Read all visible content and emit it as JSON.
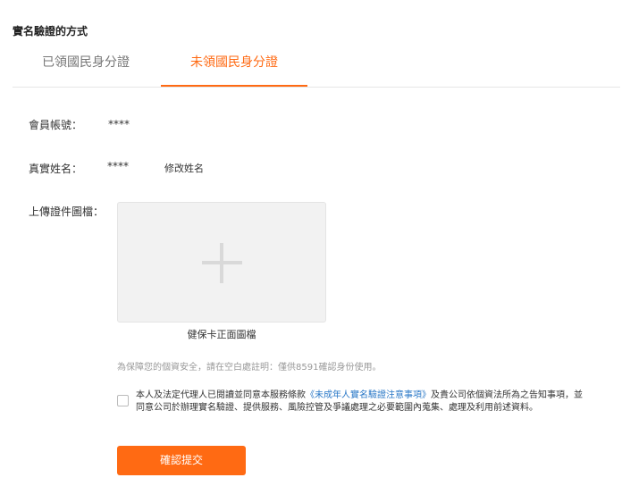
{
  "section_title": "實名驗證的方式",
  "tabs": [
    {
      "label": "已領國民身分證"
    },
    {
      "label": "未領國民身分證"
    }
  ],
  "form": {
    "member_label": "會員帳號：",
    "member_value": "****",
    "name_label": "真實姓名：",
    "name_value": "****",
    "rename_link": "修改姓名",
    "upload_label": "上傳證件圖檔：",
    "upload_caption": "健保卡正面圖檔",
    "notice": "為保障您的個資安全，請在空白處註明：僅供8591確認身份使用。",
    "agree_before": "本人及法定代理人已閱讀並同意本服務條款",
    "agree_terms": "《未成年人實名驗證注意事項》",
    "agree_after": "及貴公司依個資法所為之告知事項，並同意公司於辦理實名驗證、提供服務、風險控管及爭議處理之必要範圍內蒐集、處理及利用前述資料。",
    "submit_label": "確認提交"
  },
  "colors": {
    "accent": "#ff6a13",
    "link": "#2a78c7"
  }
}
